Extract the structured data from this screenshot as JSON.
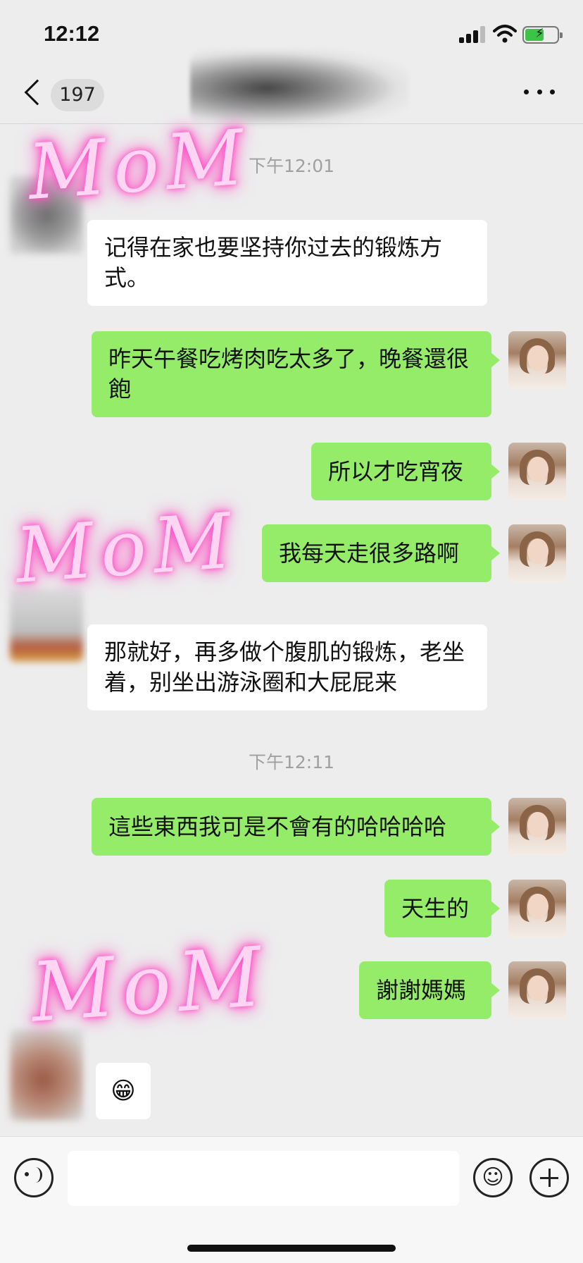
{
  "status_bar": {
    "time": "12:12",
    "icons": [
      "cellular-signal-icon",
      "wifi-icon",
      "battery-charging-icon"
    ]
  },
  "nav": {
    "unread_count": "197",
    "icons": [
      "chevron-left-icon",
      "more-icon"
    ]
  },
  "timestamps": [
    "下午12:01",
    "下午12:11"
  ],
  "messages": [
    {
      "from": "other",
      "text": "记得在家也要坚持你过去的锻炼方式。"
    },
    {
      "from": "me",
      "text": "昨天午餐吃烤肉吃太多了，晚餐還很飽"
    },
    {
      "from": "me",
      "text": "所以才吃宵夜"
    },
    {
      "from": "me",
      "text": "我每天走很多路啊"
    },
    {
      "from": "other",
      "text": "那就好，再多做个腹肌的锻炼，老坐着，别坐出游泳圈和大屁屁来"
    },
    {
      "from": "me",
      "text": "這些東西我可是不會有的哈哈哈哈"
    },
    {
      "from": "me",
      "text": "天生的"
    },
    {
      "from": "me",
      "text": "謝謝媽媽"
    },
    {
      "from": "other",
      "text": "😁"
    }
  ],
  "overlays": {
    "scribble_1": "MoM",
    "scribble_2": "MoM",
    "scribble_3": "MoM"
  },
  "input_bar": {
    "text_value": "",
    "icons": [
      "voice-icon",
      "emoji-icon",
      "plus-icon"
    ]
  },
  "colors": {
    "background": "#ededed",
    "bubble_me": "#95ec69",
    "bubble_other": "#ffffff",
    "scribble_glow": "#ff4fc7"
  }
}
